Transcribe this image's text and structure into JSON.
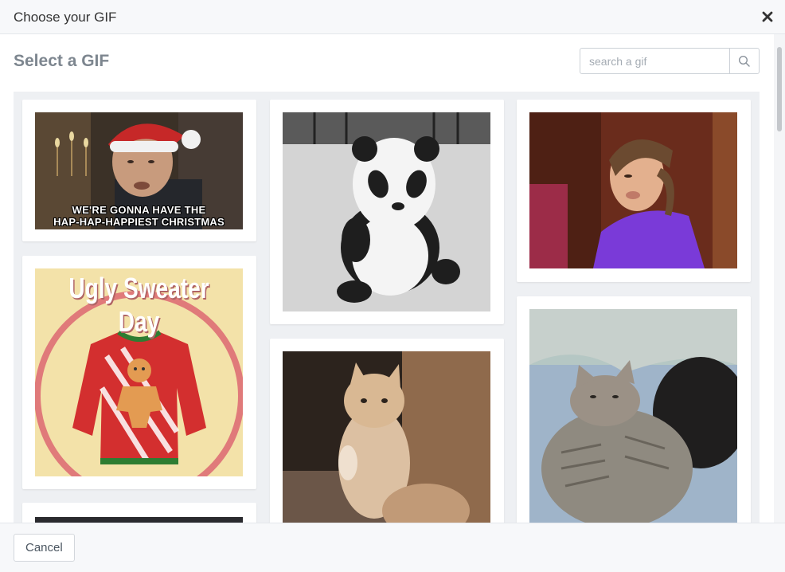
{
  "dialog": {
    "title": "Choose your GIF",
    "close_icon": "close-icon"
  },
  "content": {
    "section_title": "Select a GIF",
    "search": {
      "placeholder": "search a gif",
      "value": "",
      "icon": "search-icon"
    }
  },
  "gifs": [
    {
      "subject": "christmas-movie-clip",
      "caption_lines": [
        "WE'RE GONNA HAVE THE",
        "HAP-HAP-HAPPIEST CHRISTMAS"
      ]
    },
    {
      "subject": "ugly-sweater-day",
      "caption_lines": [
        "Ugly Sweater Day"
      ]
    },
    {
      "subject": "baby-panda"
    },
    {
      "subject": "kitten-standing"
    },
    {
      "subject": "girl-smug-face"
    },
    {
      "subject": "cuddling-kittens"
    }
  ],
  "footer": {
    "cancel_label": "Cancel"
  },
  "colors": {
    "header_bg": "#f7f8fa",
    "grid_bg": "#eef0f3",
    "title_gray": "#7d868f"
  }
}
